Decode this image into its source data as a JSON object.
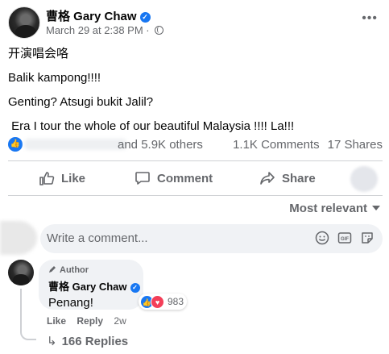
{
  "post": {
    "author": "曹格 Gary Chaw",
    "timestamp": "March 29 at 2:38 PM",
    "separator": "·",
    "privacy_icon": "globe-icon",
    "lines": [
      "开演唱会咯",
      "Balik kampong!!!!",
      "Genting? Atsugi bukit Jalil?",
      " Era I tour the whole of our beautiful Malaysia !!!! La!!!"
    ]
  },
  "reactions": {
    "summary": "and 5.9K others",
    "comments": "1.1K Comments",
    "shares": "17 Shares"
  },
  "actions": {
    "like": "Like",
    "comment": "Comment",
    "share": "Share"
  },
  "comments_section": {
    "sort_label": "Most relevant",
    "input_placeholder": "Write a comment...",
    "top_comment": {
      "badge": "Author",
      "author": "曹格 Gary Chaw",
      "text": "Penang!",
      "reaction_count": "983",
      "like": "Like",
      "reply": "Reply",
      "time": "2w",
      "replies": "166 Replies"
    }
  },
  "colors": {
    "brand_blue": "#1877f2",
    "love_red": "#f33e58",
    "secondary_text": "#65676b"
  }
}
